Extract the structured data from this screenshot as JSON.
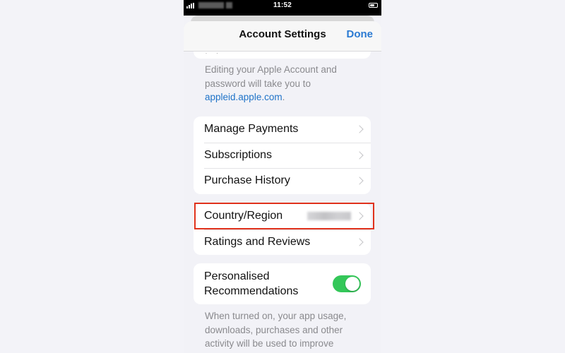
{
  "status_bar": {
    "time": "11:52",
    "carrier": "[blurred]",
    "battery_icon": "battery-icon",
    "signal_icon": "cellular-signal-icon"
  },
  "nav": {
    "title": "Account Settings",
    "done_label": "Done"
  },
  "account_note": {
    "text": "Editing your Apple Account and password will take you to ",
    "link": "appleid.apple.com",
    "suffix": "."
  },
  "payments_group": {
    "items": [
      {
        "label": "Manage Payments",
        "icon": "chevron-right-icon"
      },
      {
        "label": "Subscriptions",
        "icon": "chevron-right-icon"
      },
      {
        "label": "Purchase History",
        "icon": "chevron-right-icon"
      }
    ]
  },
  "region_group": {
    "items": [
      {
        "label": "Country/Region",
        "value": "[blurred]",
        "highlighted": true,
        "highlight_color": "#e0321c",
        "icon": "chevron-right-icon"
      },
      {
        "label": "Ratings and Reviews",
        "icon": "chevron-right-icon"
      }
    ]
  },
  "recommendations": {
    "label": "Personalised Recommendations",
    "toggle_on": true,
    "toggle_color": "#34c759",
    "footnote": "When turned on, your app usage, downloads, purchases and other activity will be used to improve"
  },
  "colors": {
    "accent": "#2a7ad2",
    "background": "#f2f2f7",
    "highlight": "#e0321c",
    "toggle_on": "#34c759"
  }
}
